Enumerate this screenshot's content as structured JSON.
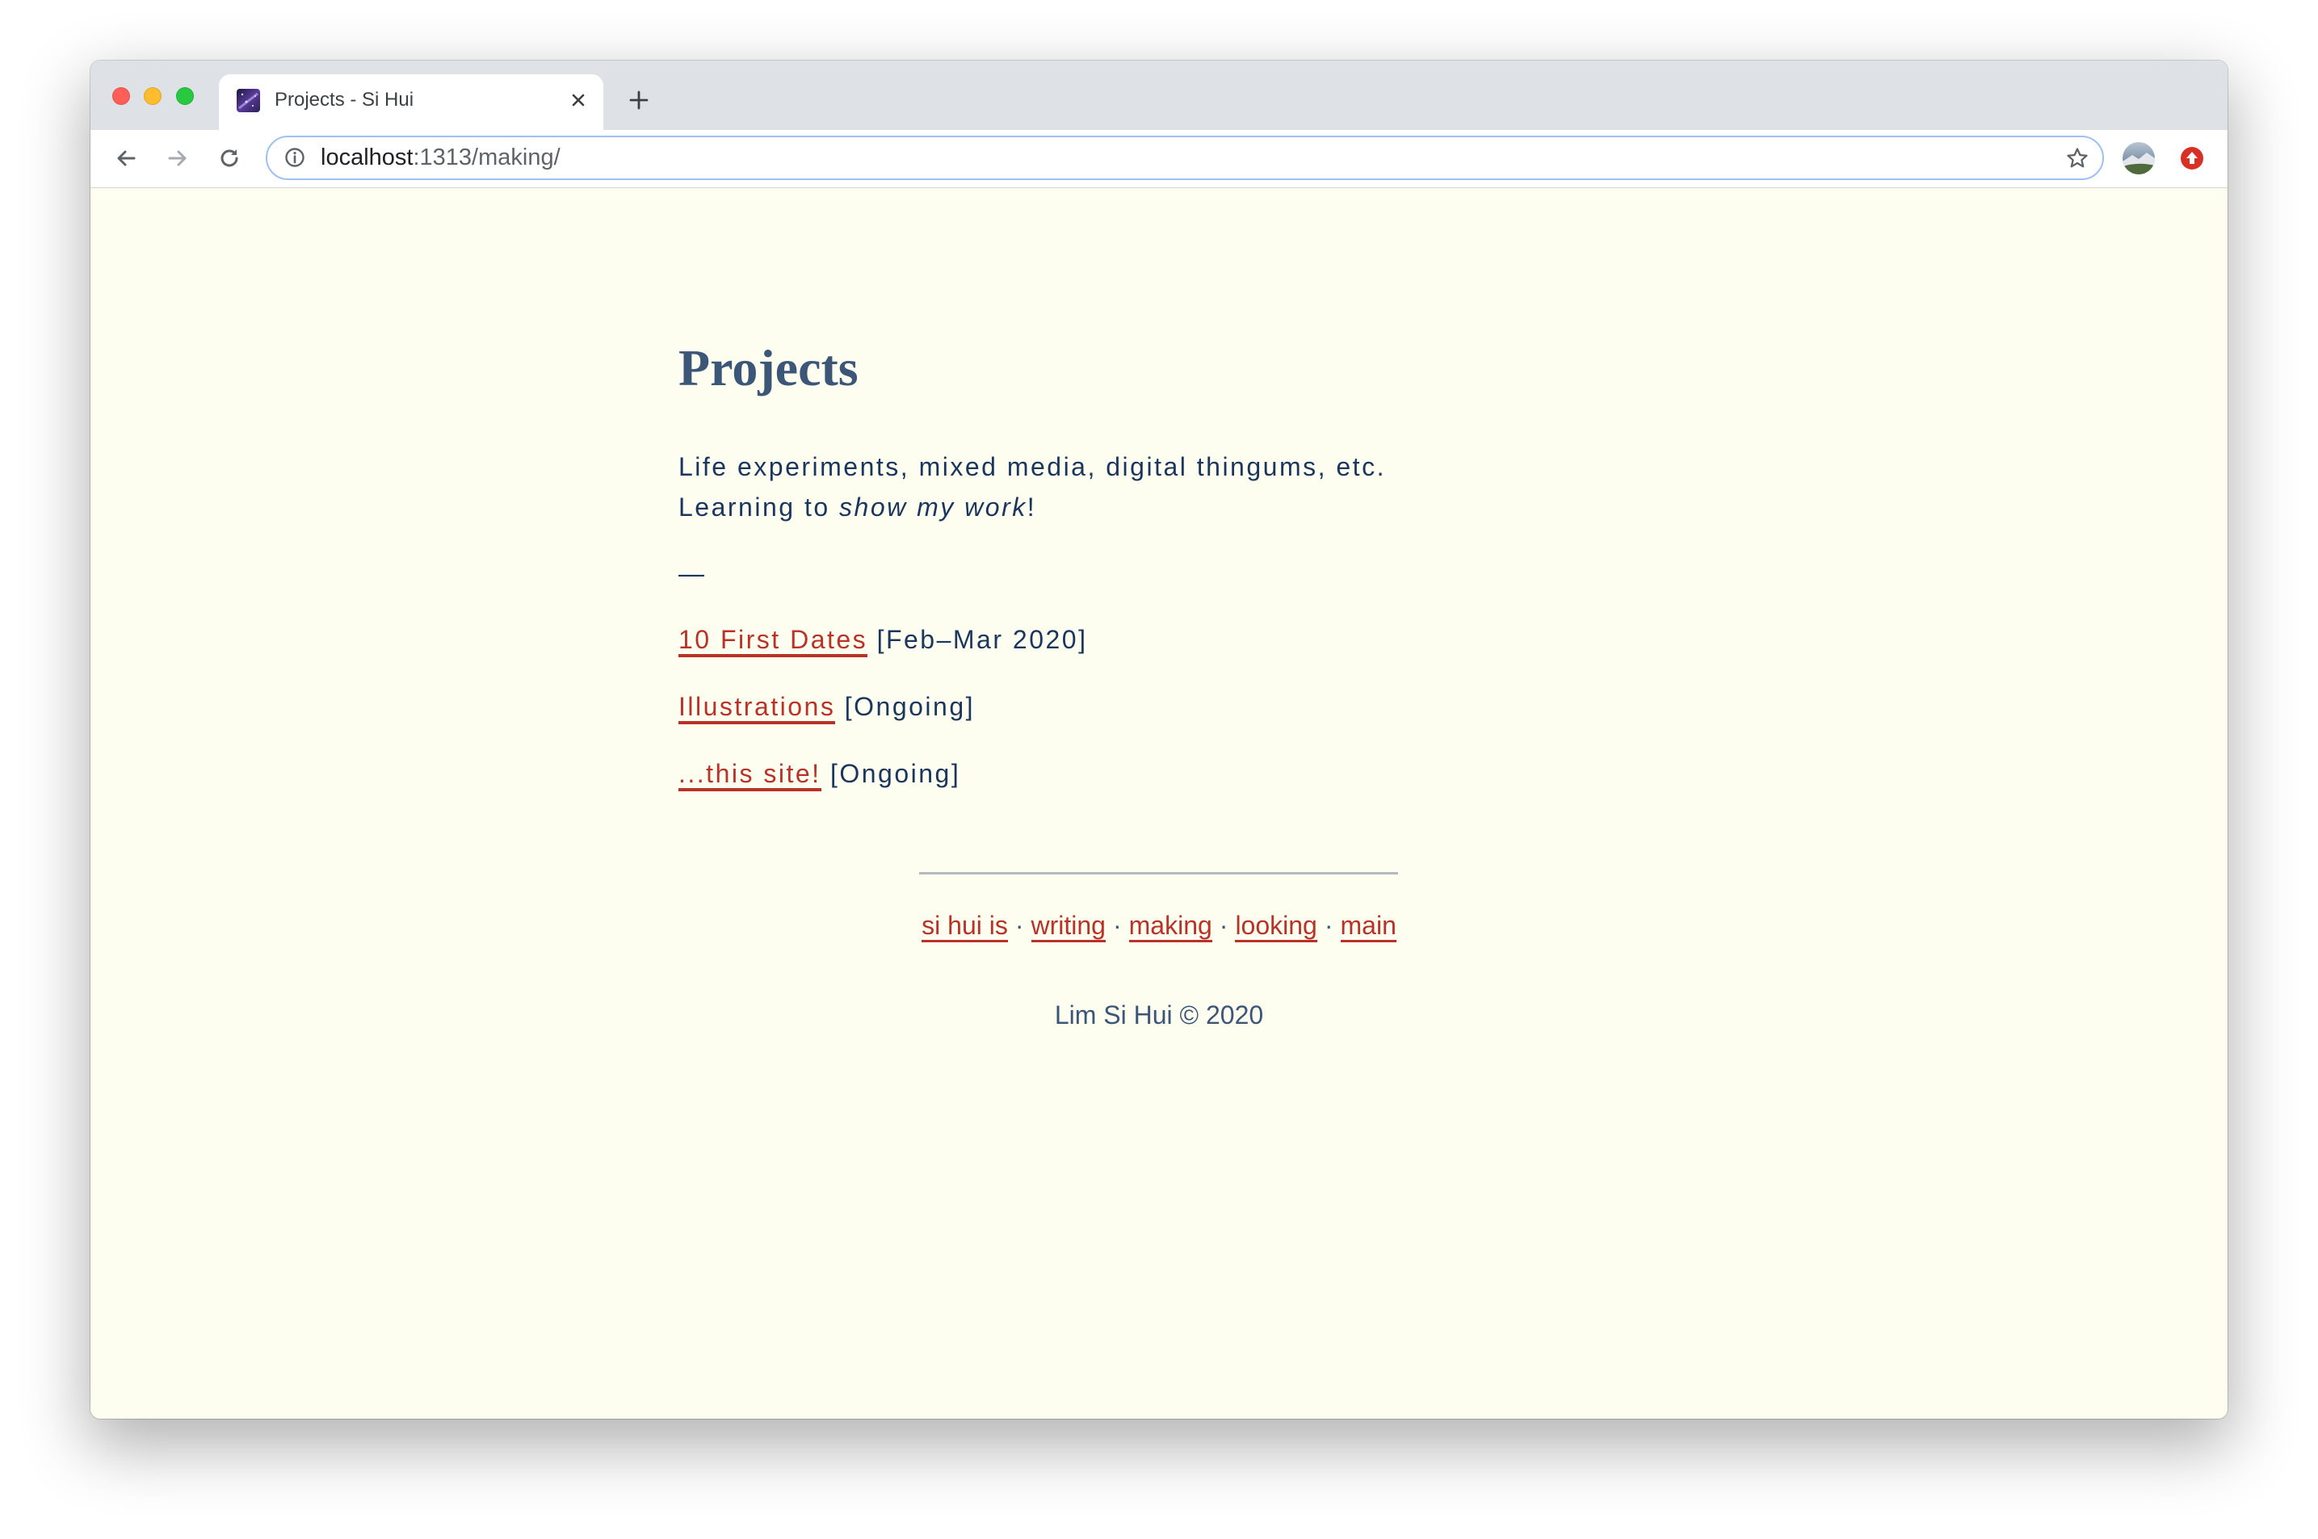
{
  "browser": {
    "traffic_light_colors": {
      "close": "#ff5f57",
      "minimize": "#febc2e",
      "zoom": "#28c840"
    },
    "tab": {
      "title": "Projects - Si Hui",
      "favicon_icon": "galaxy-favicon-icon",
      "close_icon": "close-icon"
    },
    "new_tab_icon": "plus-icon",
    "nav_icons": {
      "back": "arrow-left-icon",
      "forward": "arrow-right-icon",
      "reload": "reload-icon"
    },
    "address_bar": {
      "security_icon": "info-icon",
      "url_host": "localhost",
      "url_rest": ":1313/making/",
      "bookmark_icon": "star-icon"
    },
    "profile_icon": "avatar-icon",
    "extension_icon": "red-upload-extension-icon"
  },
  "page": {
    "title": "Projects",
    "intro": {
      "line1": "Life experiments, mixed media, digital thingums, etc.",
      "line2_prefix": "Learning to ",
      "line2_emphasis": "show my work",
      "line2_suffix": "!"
    },
    "separator": "—",
    "projects": [
      {
        "title": "10 First Dates",
        "note": "[Feb–Mar 2020]"
      },
      {
        "title": "Illustrations",
        "note": "[Ongoing]"
      },
      {
        "title": "...this site!",
        "note": "[Ongoing]"
      }
    ]
  },
  "footer": {
    "nav": [
      "si hui is",
      "writing",
      "making",
      "looking",
      "main"
    ],
    "separator": "·",
    "copyright": "Lim Si Hui © 2020"
  },
  "colors": {
    "page_background": "#fdfef0",
    "heading": "#3c5677",
    "body_text": "#1b365d",
    "link": "#b83227",
    "rule": "#b4b9c0",
    "tab_bar": "#dee1e6",
    "focus_ring": "#9fc0f5"
  }
}
